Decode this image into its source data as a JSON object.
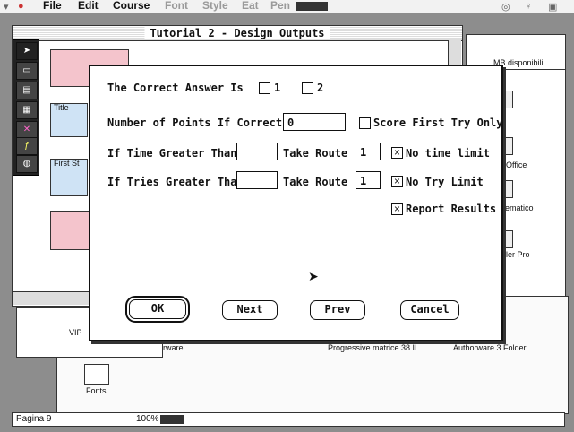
{
  "menubar": {
    "items": [
      "File",
      "Edit",
      "Course",
      "Font",
      "Style",
      "Eat",
      "Pen"
    ]
  },
  "design_window": {
    "title": "Tutorial 2 - Design Outputs",
    "icon_labels": [
      "Title",
      "First St"
    ]
  },
  "right_window": {
    "disk_info": "MB disponibili",
    "items": [
      "Office",
      "elematico",
      "ubler Pro",
      "Authorware 3 Folder"
    ]
  },
  "back_window": {
    "labels": [
      "VIP",
      "orware",
      "Progressive matrice 38 II",
      "Fonts"
    ]
  },
  "status": {
    "page": "Pagina 9",
    "zoom": "100%"
  },
  "dialog": {
    "correct_answer_label": "The Correct Answer Is",
    "answer_options": [
      {
        "label": "1",
        "checked": false
      },
      {
        "label": "2",
        "checked": false
      }
    ],
    "points_label": "Number of Points If Correct",
    "points_value": "0",
    "score_first_try": {
      "label": "Score First Try Only",
      "checked": false
    },
    "time_label": "If Time Greater Than",
    "time_value": "",
    "take_route_label": "Take Route",
    "time_route_value": "1",
    "no_time_limit": {
      "label": "No time limit",
      "checked": true
    },
    "tries_label": "If Tries Greater Than",
    "tries_value": "",
    "tries_route_value": "1",
    "no_try_limit": {
      "label": "No Try Limit",
      "checked": true
    },
    "report_results": {
      "label": "Report Results",
      "checked": true
    },
    "buttons": {
      "ok": "OK",
      "next": "Next",
      "prev": "Prev",
      "cancel": "Cancel"
    }
  }
}
